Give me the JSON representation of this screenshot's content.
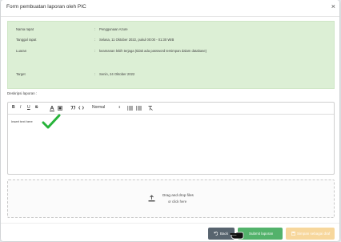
{
  "modal": {
    "title": "Form pembuatan laporan oleh PIC",
    "close_icon": "close-icon"
  },
  "info": {
    "rows": [
      {
        "label": "Nama rapat",
        "colon": ":",
        "value": "Penggunaan Azure"
      },
      {
        "label": "Tanggal rapat",
        "colon": ":",
        "value": "Selasa, 11 Oktober 2022, pukul 00:00 - 01:30 WIB"
      },
      {
        "label": "Luaran",
        "colon": ":",
        "value": "keamanan lebih terjaga (tidak ada password tersimpan dalam database)"
      },
      {
        "label": "Target",
        "colon": ":",
        "value": "Senin, 24 Oktober 2022"
      }
    ],
    "background_color": "#dcefd5"
  },
  "description": {
    "label": "Deskripsi laporan :",
    "toolbar": {
      "bold": "B",
      "italic": "I",
      "underline": "U",
      "strike": "S",
      "format_select": "Normal"
    },
    "content": "Insert text here",
    "check_icon": "checkmark-icon"
  },
  "dropzone": {
    "main": "Drag and drop files",
    "sub": "or click here",
    "icon": "upload-icon"
  },
  "buttons": {
    "back": "Back",
    "submit": "Submit laporan",
    "disabled": "Simpan sebagai draf"
  },
  "colors": {
    "back": "#58646f",
    "submit": "#53b26b",
    "disabled": "#f7d79c"
  }
}
